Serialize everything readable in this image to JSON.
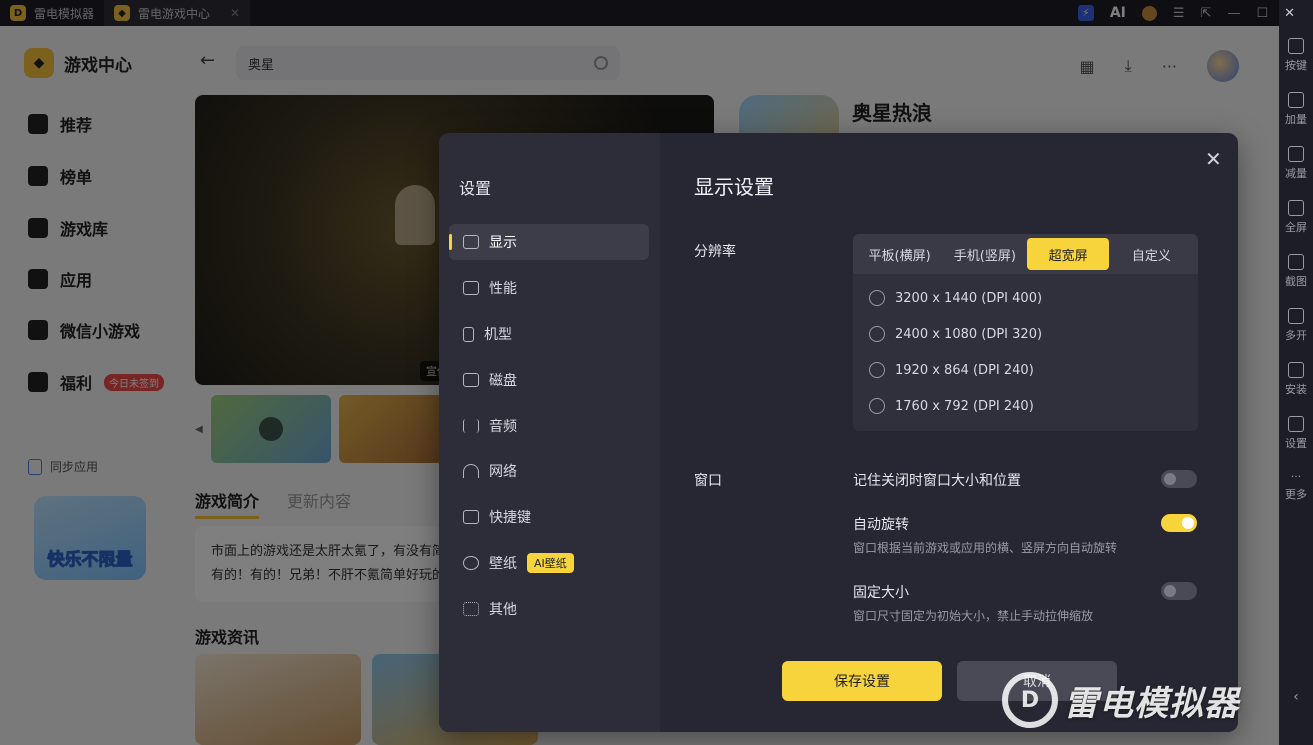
{
  "titlebar": {
    "tabs": [
      {
        "label": "雷电模拟器"
      },
      {
        "label": "雷电游戏中心"
      }
    ],
    "ai_label": "AI"
  },
  "right_toolbar": [
    "按键",
    "加量",
    "减量",
    "全屏",
    "截图",
    "多开",
    "安装",
    "设置",
    "更多"
  ],
  "left_nav": {
    "app_title": "游戏中心",
    "items": [
      {
        "label": "推荐"
      },
      {
        "label": "榜单"
      },
      {
        "label": "游戏库"
      },
      {
        "label": "应用"
      },
      {
        "label": "微信小游戏"
      },
      {
        "label": "福利",
        "badge": "今日未签到"
      }
    ],
    "sync_label": "同步应用",
    "promo_text": "快乐不限量"
  },
  "main": {
    "search_value": "奥星",
    "hero_tag": "宣传",
    "game_title": "奥星热浪",
    "tabs": [
      "游戏简介",
      "更新内容"
    ],
    "intro_lines": [
      "市面上的游戏还是太肝太氪了，有没有简",
      "有的！有的！兄弟！不肝不氪简单好玩的"
    ],
    "news_title": "游戏资讯"
  },
  "dialog": {
    "sidebar_title": "设置",
    "sidebar_items": [
      {
        "label": "显示",
        "icon": "monitor-icon",
        "active": true
      },
      {
        "label": "性能",
        "icon": "performance-icon"
      },
      {
        "label": "机型",
        "icon": "phone-icon"
      },
      {
        "label": "磁盘",
        "icon": "disk-icon"
      },
      {
        "label": "音频",
        "icon": "audio-icon"
      },
      {
        "label": "网络",
        "icon": "wifi-icon"
      },
      {
        "label": "快捷键",
        "icon": "keyboard-icon"
      },
      {
        "label": "壁纸",
        "icon": "palette-icon",
        "badge": "AI壁纸"
      },
      {
        "label": "其他",
        "icon": "grid-icon"
      }
    ],
    "title": "显示设置",
    "resolution": {
      "label": "分辨率",
      "tabs": [
        "平板(横屏)",
        "手机(竖屏)",
        "超宽屏",
        "自定义"
      ],
      "selected_tab": "超宽屏",
      "options": [
        "3200 x 1440  (DPI 400)",
        "2400 x 1080  (DPI 320)",
        "1920 x 864  (DPI 240)",
        "1760 x 792  (DPI 240)"
      ]
    },
    "window": {
      "label": "窗口",
      "options": [
        {
          "title": "记住关闭时窗口大小和位置",
          "desc": "",
          "on": false
        },
        {
          "title": "自动旋转",
          "desc": "窗口根据当前游戏或应用的横、竖屏方向自动旋转",
          "on": true
        },
        {
          "title": "固定大小",
          "desc": "窗口尺寸固定为初始大小，禁止手动拉伸缩放",
          "on": false
        }
      ]
    },
    "save_label": "保存设置",
    "cancel_label": "取消"
  },
  "watermark": {
    "text": "雷电模拟器"
  },
  "colors": {
    "accent": "#f7d43b",
    "dialog_bg": "#272733",
    "titlebar_bg": "#1d1d26"
  }
}
